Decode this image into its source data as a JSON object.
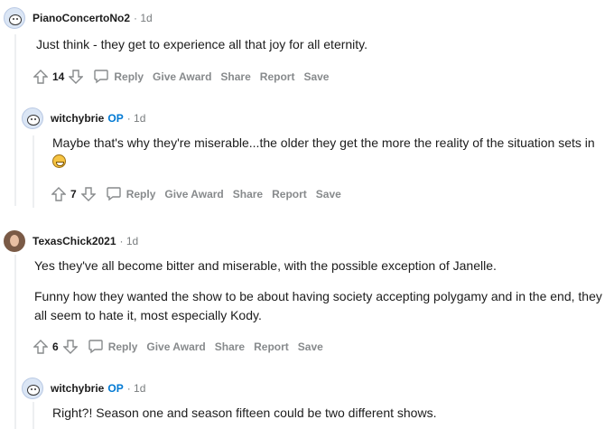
{
  "comments": [
    {
      "username": "PianoConcertoNo2",
      "op": "",
      "age": "· 1d",
      "paragraphs": [
        "Just think - they get to experience all that joy for all eternity."
      ],
      "score": "14",
      "actions": {
        "reply": "Reply",
        "award": "Give Award",
        "share": "Share",
        "report": "Report",
        "save": "Save"
      },
      "avatar": "snoo-avatar"
    },
    {
      "username": "witchybrie",
      "op": "OP",
      "age": "· 1d",
      "paragraphs": [
        "Maybe that's why they're miserable...the older they get the more the reality of the situation sets in"
      ],
      "emoji": "grinning-sweat-emoji",
      "score": "7",
      "actions": {
        "reply": "Reply",
        "award": "Give Award",
        "share": "Share",
        "report": "Report",
        "save": "Save"
      },
      "avatar": "snoo-avatar"
    },
    {
      "username": "TexasChick2021",
      "op": "",
      "age": "· 1d",
      "paragraphs": [
        "Yes they've all become bitter and miserable, with the possible exception of Janelle.",
        "Funny how they wanted the show to be about having society accepting polygamy and in the end, they all seem to hate it, most especially Kody."
      ],
      "score": "6",
      "actions": {
        "reply": "Reply",
        "award": "Give Award",
        "share": "Share",
        "report": "Report",
        "save": "Save"
      },
      "avatar": "photo-avatar"
    },
    {
      "username": "witchybrie",
      "op": "OP",
      "age": "· 1d",
      "paragraphs": [
        "Right?! Season one and season fifteen could be two different shows."
      ],
      "avatar": "snoo-avatar"
    }
  ],
  "colors": {
    "op": "#0079d3",
    "meta": "#787c7e",
    "action": "#878a8c",
    "line": "#edeff1"
  }
}
